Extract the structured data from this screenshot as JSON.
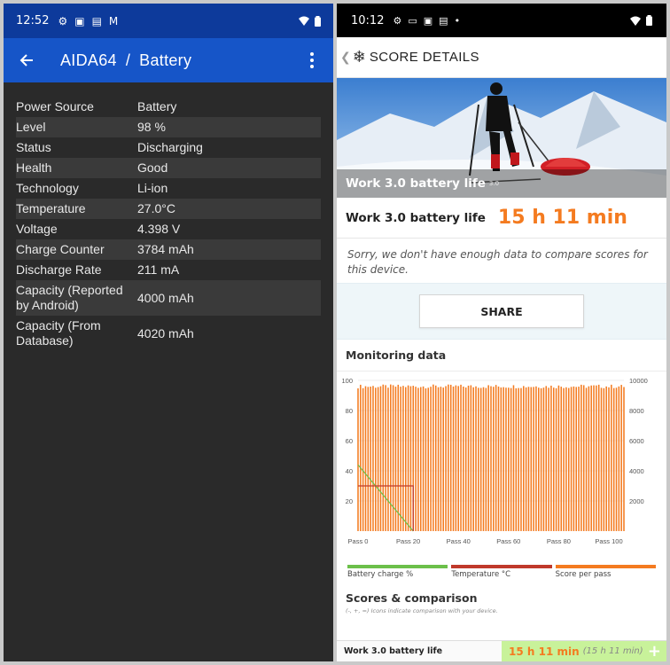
{
  "left": {
    "status": {
      "time": "12:52"
    },
    "toolbar": {
      "app": "AIDA64",
      "separator": "/",
      "section": "Battery"
    },
    "rows": [
      {
        "key": "Power Source",
        "value": "Battery"
      },
      {
        "key": "Level",
        "value": "98 %"
      },
      {
        "key": "Status",
        "value": "Discharging"
      },
      {
        "key": "Health",
        "value": "Good"
      },
      {
        "key": "Technology",
        "value": "Li-ion"
      },
      {
        "key": "Temperature",
        "value": "27.0°C"
      },
      {
        "key": "Voltage",
        "value": "4.398 V"
      },
      {
        "key": "Charge Counter",
        "value": "3784 mAh"
      },
      {
        "key": "Discharge Rate",
        "value": "211 mA"
      },
      {
        "key": "Capacity (Reported by Android)",
        "value": "4000 mAh"
      },
      {
        "key": "Capacity (From Database)",
        "value": "4020 mAh"
      }
    ]
  },
  "right": {
    "status": {
      "time": "10:12"
    },
    "header": {
      "title": "SCORE DETAILS"
    },
    "hero": {
      "caption": "Work 3.0 battery life",
      "version": "3.0"
    },
    "score": {
      "label": "Work 3.0 battery life",
      "value": "15 h 11 min"
    },
    "note": "Sorry, we don't have enough data to compare scores for this device.",
    "share_label": "SHARE",
    "monitoring_title": "Monitoring data",
    "legend": [
      {
        "label": "Battery charge %",
        "color": "#6cc04a"
      },
      {
        "label": "Temperature °C",
        "color": "#c0392b"
      },
      {
        "label": "Score per pass",
        "color": "#f47b20"
      }
    ],
    "scores_title": "Scores & comparison",
    "scores_note": "(-, +, =) Icons indicate comparison with your device.",
    "bottom": {
      "label": "Work 3.0 battery life",
      "value": "15 h 11 min",
      "secondary": "(15 h 11 min)"
    }
  },
  "chart_data": {
    "type": "bar",
    "x_ticks": [
      "Pass 0",
      "Pass 20",
      "Pass 40",
      "Pass 60",
      "Pass 80",
      "Pass 100"
    ],
    "y_left_ticks": [
      "20",
      "40",
      "60",
      "80",
      "100"
    ],
    "y_right_ticks": [
      "2000",
      "4000",
      "6000",
      "8000",
      "10000"
    ],
    "ylim_left": [
      0,
      100
    ],
    "ylim_right": [
      0,
      10000
    ],
    "passes": 107,
    "score_per_pass_approx": 9600,
    "battery_charge_end_pass": 22,
    "temperature_level": 30,
    "temperature_end_pass": 22,
    "colors": {
      "score": "#f47b20",
      "battery": "#6cc04a",
      "temperature": "#c0392b"
    }
  }
}
